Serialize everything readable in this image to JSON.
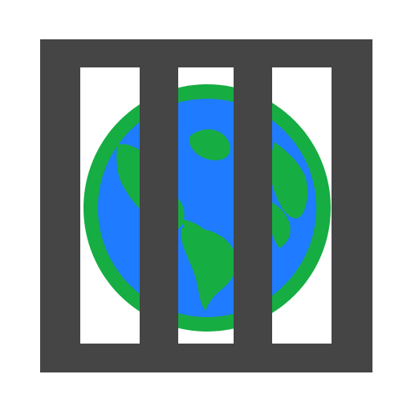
{
  "icon": {
    "name": "globe-behind-bars-icon",
    "colors": {
      "background": "#ffffff",
      "frame": "#454545",
      "earth_border": "#16ad43",
      "ocean": "#1f7bff",
      "land": "#16ad43"
    }
  }
}
